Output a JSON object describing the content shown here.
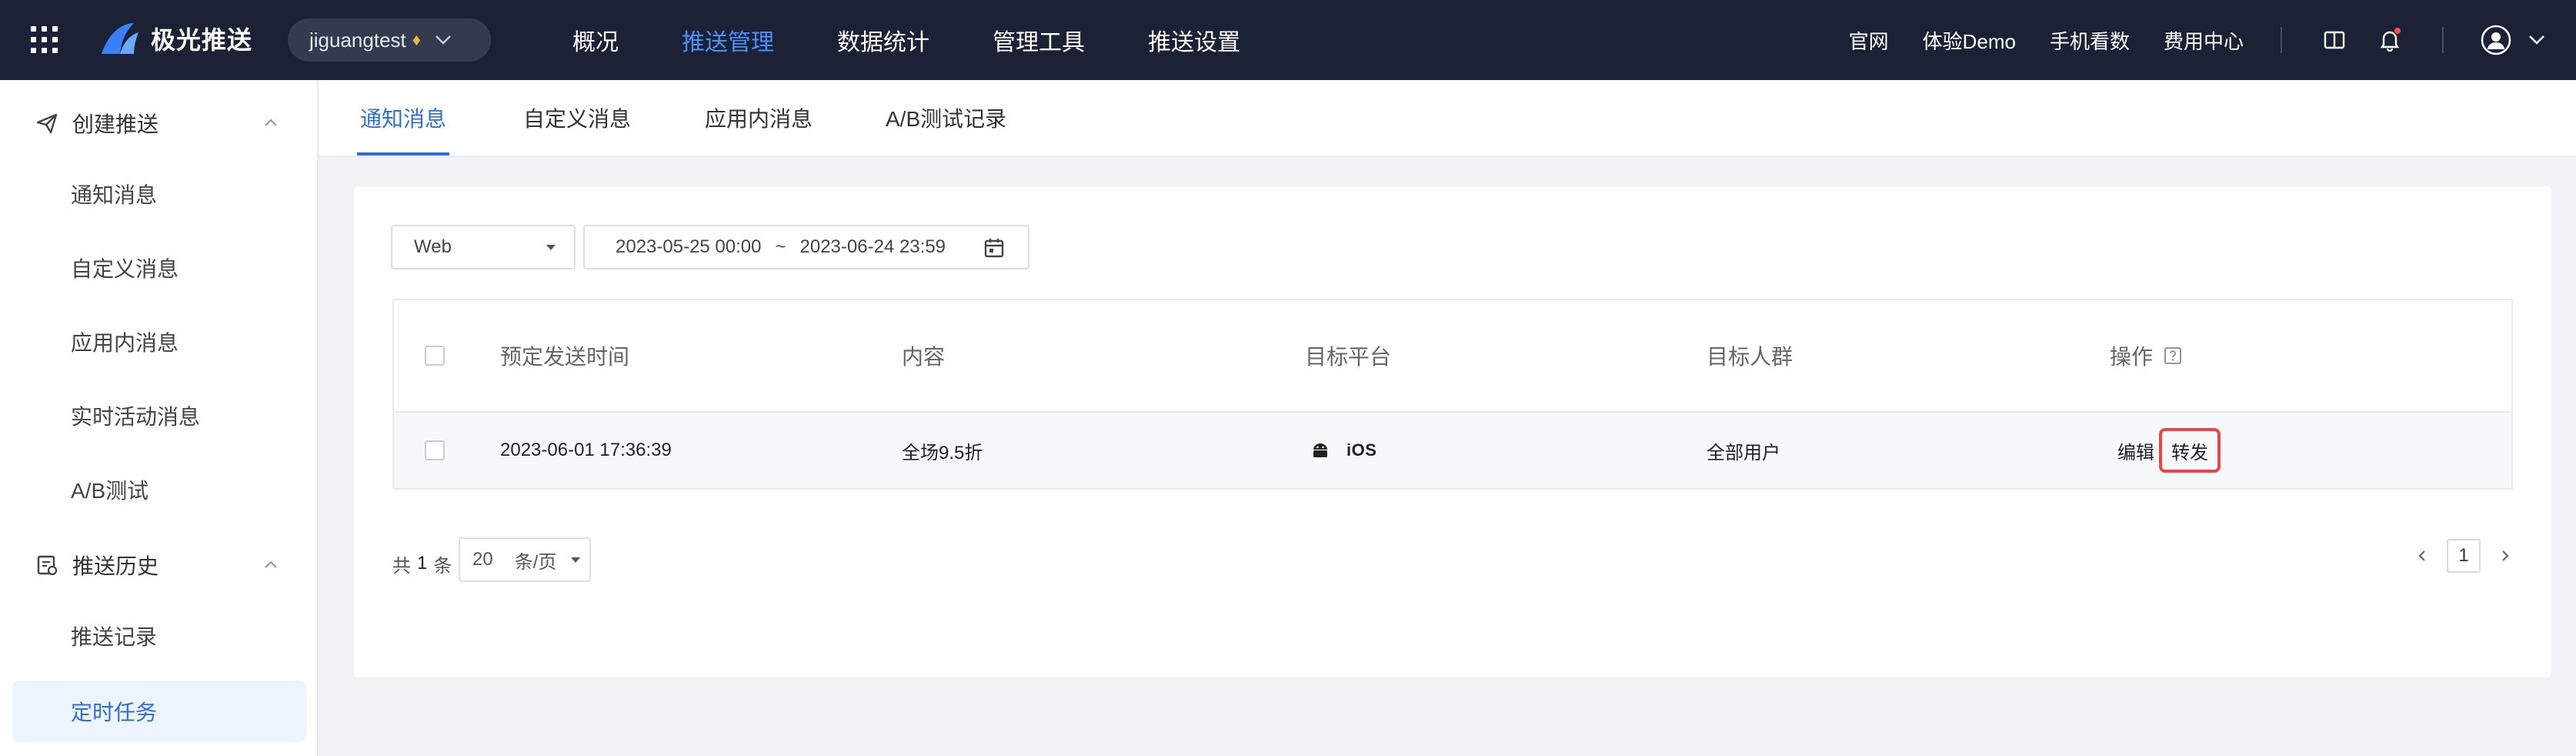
{
  "topbar": {
    "logo_text": "极光推送",
    "app_name": "jiguangtest",
    "nav": [
      {
        "label": "概况"
      },
      {
        "label": "推送管理"
      },
      {
        "label": "数据统计"
      },
      {
        "label": "管理工具"
      },
      {
        "label": "推送设置"
      }
    ],
    "active_nav": "推送管理",
    "links": [
      {
        "label": "官网"
      },
      {
        "label": "体验Demo"
      },
      {
        "label": "手机看数"
      },
      {
        "label": "费用中心"
      }
    ]
  },
  "sidebar": {
    "groups": [
      {
        "label": "创建推送",
        "items": [
          {
            "label": "通知消息"
          },
          {
            "label": "自定义消息"
          },
          {
            "label": "应用内消息"
          },
          {
            "label": "实时活动消息"
          },
          {
            "label": "A/B测试"
          }
        ]
      },
      {
        "label": "推送历史",
        "items": [
          {
            "label": "推送记录"
          },
          {
            "label": "定时任务"
          }
        ]
      }
    ],
    "active_item": "定时任务"
  },
  "tabs": [
    {
      "label": "通知消息"
    },
    {
      "label": "自定义消息"
    },
    {
      "label": "应用内消息"
    },
    {
      "label": "A/B测试记录"
    }
  ],
  "active_tab": "通知消息",
  "filters": {
    "platform_value": "Web",
    "date_start": "2023-05-25 00:00",
    "date_separator": "~",
    "date_end": "2023-06-24 23:59"
  },
  "table": {
    "columns": [
      "预定发送时间",
      "内容",
      "目标平台",
      "目标人群",
      "操作"
    ],
    "rows": [
      {
        "time": "2023-06-01 17:36:39",
        "content": "全场9.5折",
        "platform_label": "iOS",
        "audience": "全部用户",
        "actions": [
          "编辑",
          "转发"
        ]
      }
    ]
  },
  "pagination": {
    "total_prefix": "共",
    "total_count": "1",
    "total_suffix": "条",
    "page_size": "20",
    "page_size_unit": "条/页",
    "current_page": "1"
  },
  "colors": {
    "topbar_bg": "#1b2236",
    "accent": "#2f6fd8",
    "highlight_box": "#e64848"
  }
}
